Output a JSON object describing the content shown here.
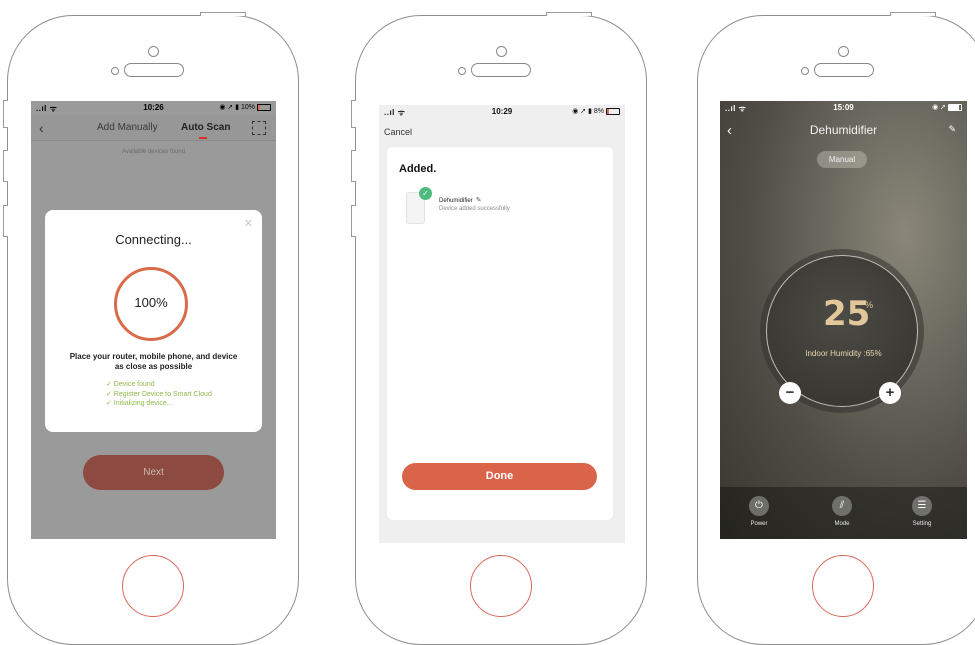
{
  "screen1": {
    "status": {
      "signal": "..ıl ᯤ",
      "time": "10:26",
      "right": "◉ ➚ ▮ 10%"
    },
    "header": {
      "tab_manual": "Add Manually",
      "tab_auto": "Auto Scan"
    },
    "available_text": "Available devices found",
    "dialog": {
      "title": "Connecting...",
      "progress": "100%",
      "progress_value": 1.0,
      "hint_line1": "Place your router, mobile phone, and device",
      "hint_line2": "as close as possible",
      "steps": [
        "✓ Device found",
        "✓ Register Device to Smart Cloud",
        "✓ Initializing device..."
      ]
    },
    "next_label": "Next"
  },
  "screen2": {
    "status": {
      "signal": "..ıl ᯤ",
      "time": "10:29",
      "right": "◉ ➚ ▮ 8%"
    },
    "cancel_label": "Cancel",
    "added_title": "Added.",
    "device": {
      "name": "Dehumidifier",
      "status": "Device added successfully"
    },
    "done_label": "Done"
  },
  "screen3": {
    "status": {
      "signal": "..ıl ᯤ",
      "time": "15:09",
      "right": "◉ ➚"
    },
    "title": "Dehumidifier",
    "mode_chip": "Manual",
    "humidity_value": "25",
    "humidity_unit": "%",
    "indoor_text": "Indoor Humidity :65%",
    "bottom": [
      {
        "label": "Power",
        "icon": "power-icon"
      },
      {
        "label": "Mode",
        "icon": "mode-icon"
      },
      {
        "label": "Setting",
        "icon": "setting-icon"
      }
    ]
  },
  "colors": {
    "accent": "#d9644a",
    "success": "#4fb97e",
    "step_green": "#92b84c"
  }
}
